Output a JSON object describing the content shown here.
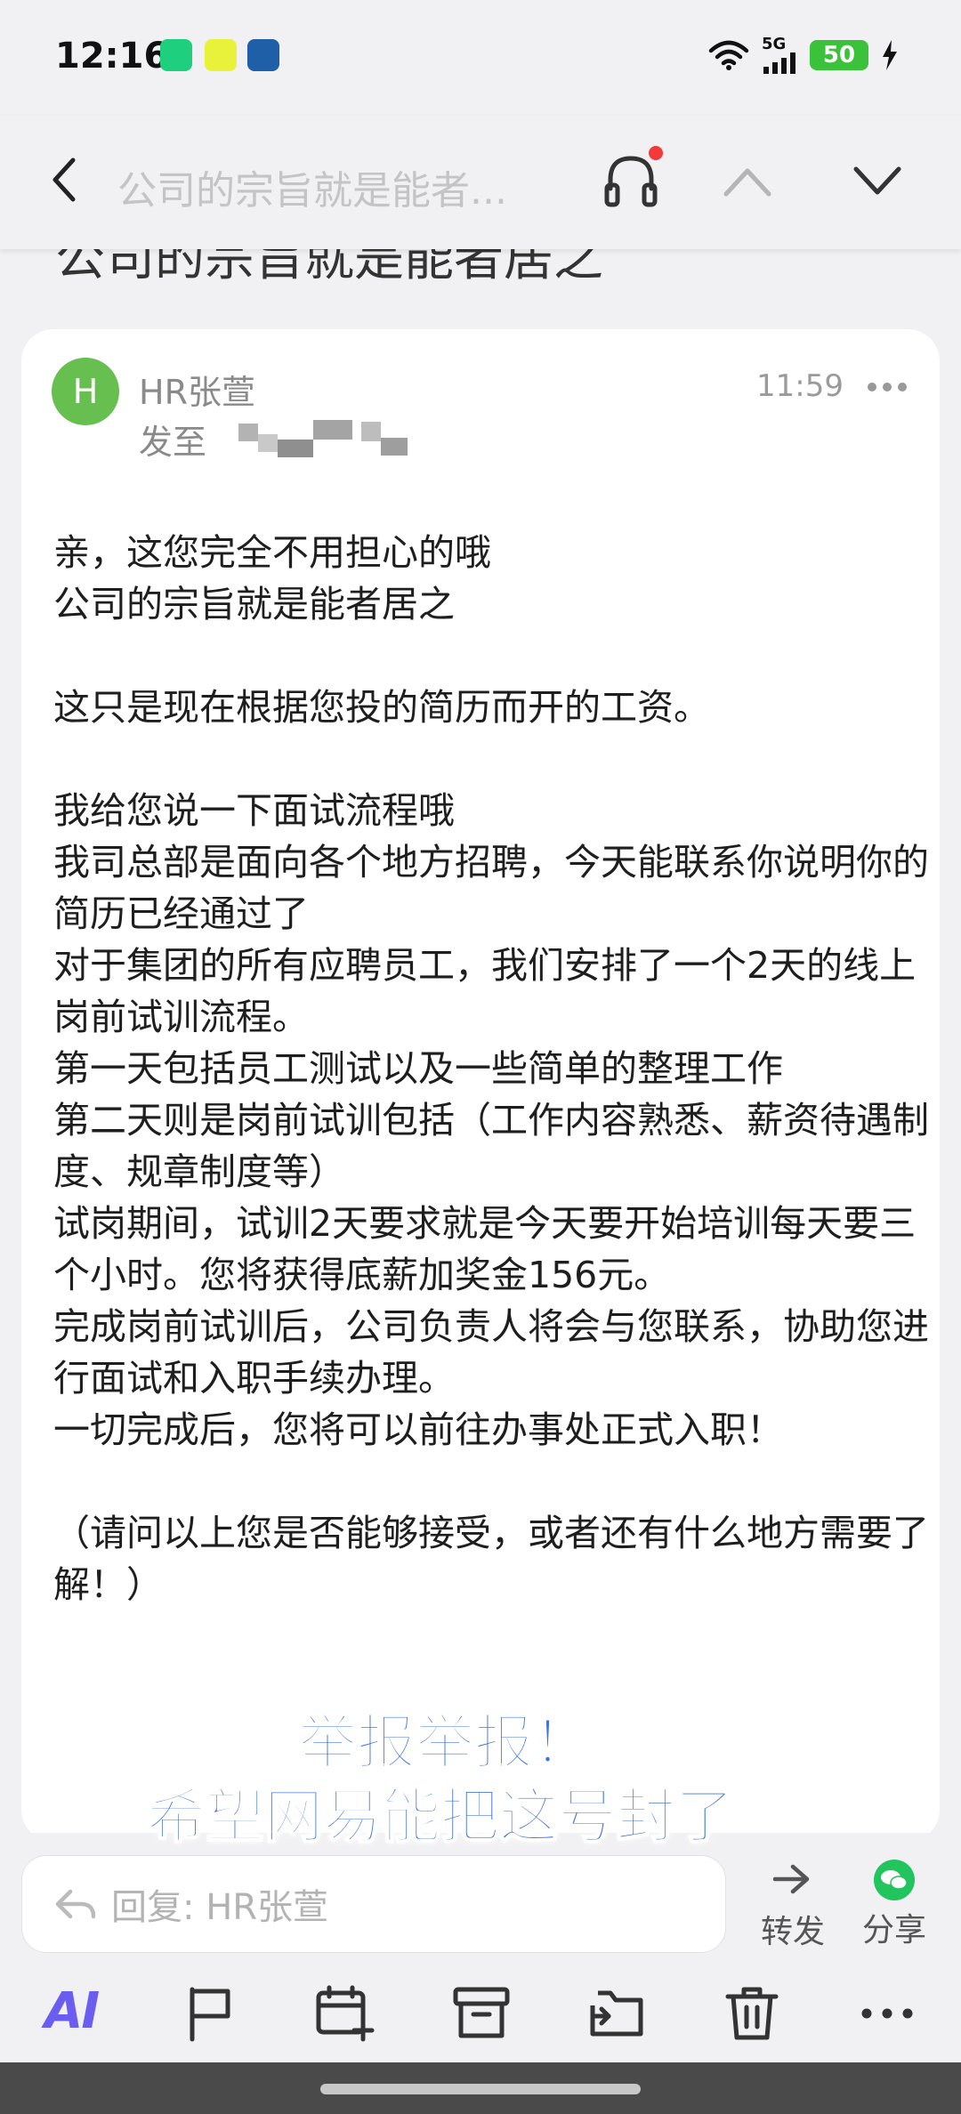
{
  "status_bar": {
    "time": "12:16",
    "network": "5G",
    "battery": "50"
  },
  "nav": {
    "title": "公司的宗旨就是能者..."
  },
  "behind_subject": "公司的宗旨就是能者居之",
  "email": {
    "avatar_letter": "H",
    "sender": "HR张萱",
    "to_label": "发至",
    "time": "11:59",
    "body": [
      "亲，这您完全不用担心的哦",
      "公司的宗旨就是能者居之",
      "",
      "这只是现在根据您投的简历而开的工资。",
      "",
      "我给您说一下面试流程哦",
      "我司总部是面向各个地方招聘，今天能联系你说明你的简历已经通过了",
      "对于集团的所有应聘员工，我们安排了一个2天的线上岗前试训流程。",
      "第一天包括员工测试以及一些简单的整理工作",
      "第二天则是岗前试训包括（工作内容熟悉、薪资待遇制度、规章制度等）",
      "试岗期间，试训2天要求就是今天要开始培训每天要三个小时。您将获得底薪加奖金156元。",
      "完成岗前试训后，公司负责人将会与您联系，协助您进行面试和入职手续办理。",
      "一切完成后，您将可以前往办事处正式入职！",
      "",
      "（请问以上您是否能够接受，或者还有什么地方需要了解！）"
    ]
  },
  "overlay_caption": {
    "line1": "举报举报！",
    "line2": "希望网易能把这号封了"
  },
  "reply_bar": {
    "placeholder": "回复: HR张萱",
    "forward_label": "转发",
    "share_label": "分享"
  },
  "toolbar": {
    "ai_label": "AI",
    "icons": [
      "flag-icon",
      "calendar-add-icon",
      "archive-icon",
      "move-folder-icon",
      "trash-icon",
      "more-icon"
    ]
  },
  "colors": {
    "accent_ai": "#6b5df0",
    "avatar": "#67bf50",
    "overlay_text": "#3f74d8",
    "battery": "#3ac33a",
    "wechat": "#22c45e"
  }
}
